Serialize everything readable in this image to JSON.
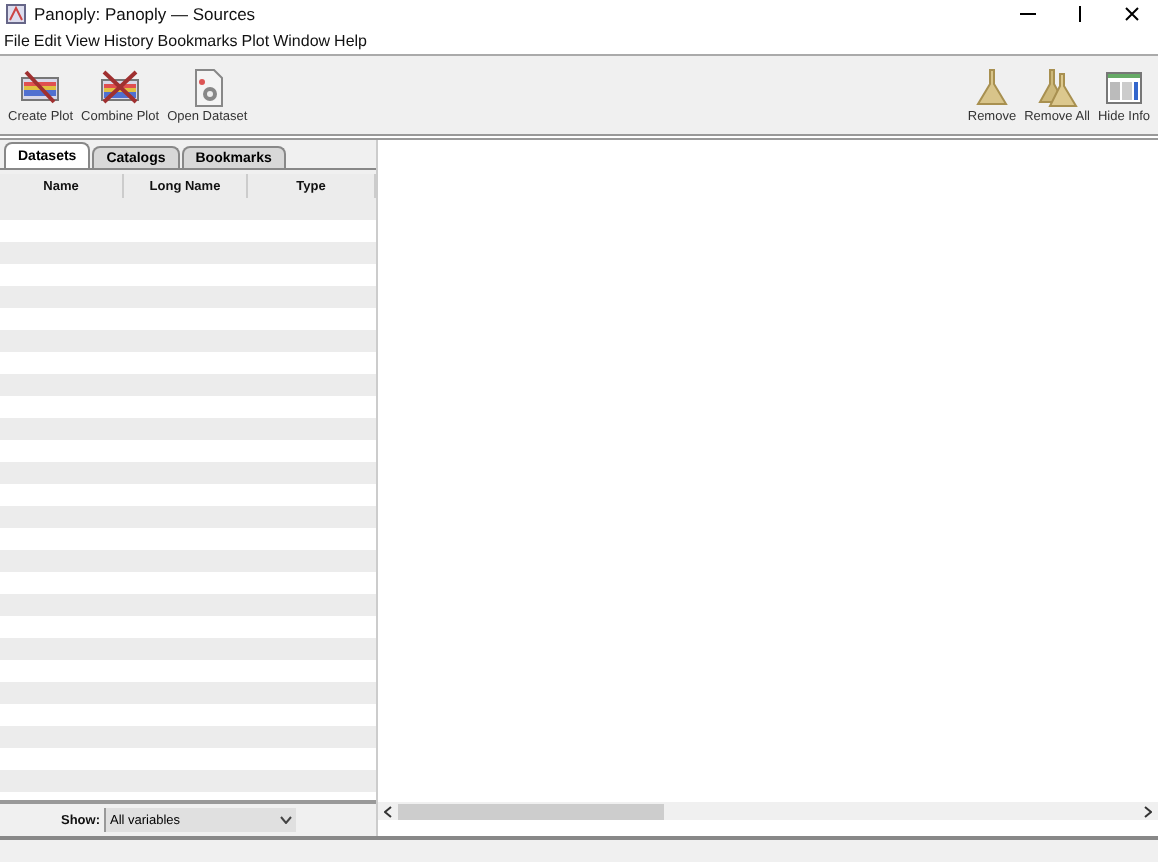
{
  "window": {
    "title": "Panoply: Panoply — Sources"
  },
  "menu": [
    "File",
    "Edit",
    "View",
    "History",
    "Bookmarks",
    "Plot",
    "Window",
    "Help"
  ],
  "toolbar_left": [
    {
      "label": "Create Plot",
      "kind": "create"
    },
    {
      "label": "Combine Plot",
      "kind": "combine"
    },
    {
      "label": "Open Dataset",
      "kind": "open"
    }
  ],
  "toolbar_right": [
    {
      "label": "Remove",
      "kind": "remove"
    },
    {
      "label": "Remove All",
      "kind": "remove_all"
    },
    {
      "label": "Hide Info",
      "kind": "info"
    }
  ],
  "tabs": [
    {
      "label": "Datasets",
      "selected": true
    },
    {
      "label": "Catalogs",
      "selected": false
    },
    {
      "label": "Bookmarks",
      "selected": false
    }
  ],
  "table": {
    "columns": [
      "Name",
      "Long Name",
      "Type"
    ]
  },
  "filter": {
    "label": "Show:",
    "value": "All variables"
  }
}
